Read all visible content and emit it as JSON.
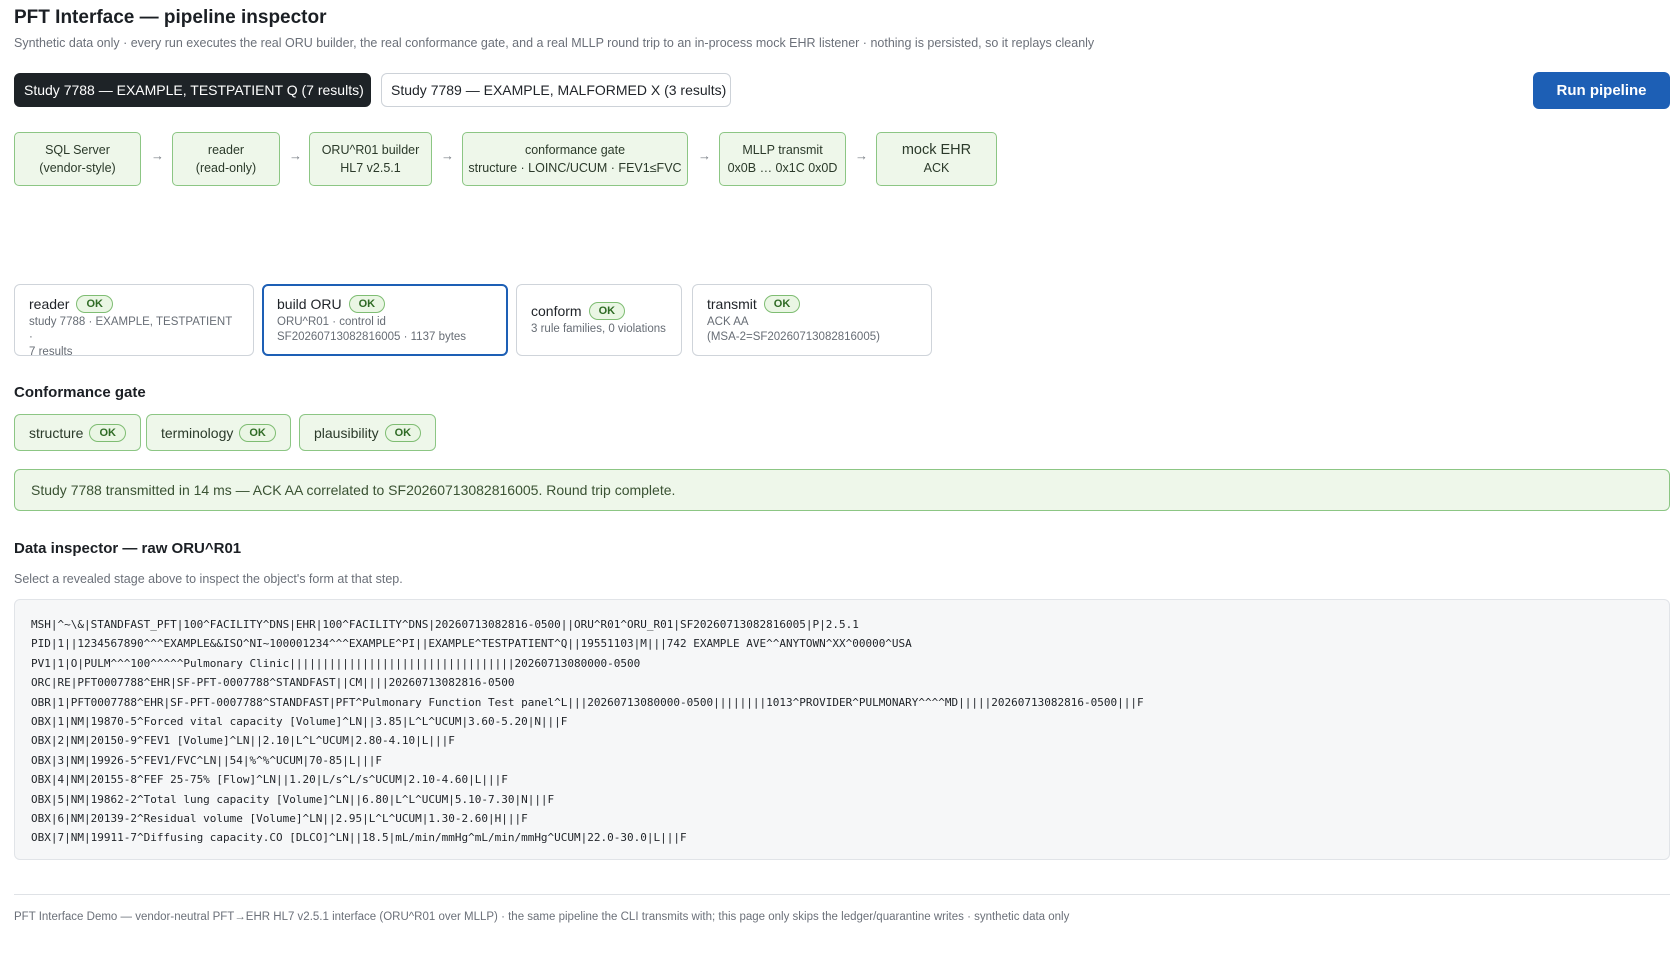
{
  "header": {
    "title": "PFT Interface — pipeline inspector",
    "subtitle": "Synthetic data only · every run executes the real ORU builder, the real conformance gate, and a real MLLP round trip to an in-process mock EHR listener · nothing is persisted, so it replays cleanly"
  },
  "studies": [
    {
      "label": "Study 7788 — EXAMPLE, TESTPATIENT Q (7 results)",
      "selected": true
    },
    {
      "label": "Study 7789 — EXAMPLE, MALFORMED X (3 results)",
      "selected": false
    }
  ],
  "run_button": "Run pipeline",
  "pipeline": [
    {
      "line1": "SQL Server",
      "line2": "(vendor-style)"
    },
    {
      "line1": "reader",
      "line2": "(read-only)"
    },
    {
      "line1": "ORU^R01 builder",
      "line2": "HL7 v2.5.1"
    },
    {
      "line1": "conformance gate",
      "line2": "structure · LOINC/UCUM · FEV1≤FVC"
    },
    {
      "line1": "MLLP transmit",
      "line2": "0x0B … 0x1C 0x0D"
    },
    {
      "line1": "mock EHR",
      "line2": "ACK"
    }
  ],
  "pipeline_arrow": "→",
  "ok_label": "OK",
  "stages": [
    {
      "name": "reader",
      "detail1": "study 7788 · EXAMPLE, TESTPATIENT ·",
      "detail2": "7 results",
      "status": "OK"
    },
    {
      "name": "build ORU",
      "detail1": "ORU^R01 · control id",
      "detail2": "SF20260713082816005 · 1137 bytes",
      "status": "OK",
      "selected": true
    },
    {
      "name": "conform",
      "detail1": "3 rule families, 0 violations",
      "detail2": "",
      "status": "OK"
    },
    {
      "name": "transmit",
      "detail1": "ACK AA",
      "detail2": "(MSA-2=SF20260713082816005)",
      "status": "OK"
    }
  ],
  "conformance": {
    "title": "Conformance gate",
    "families": [
      {
        "name": "structure",
        "status": "OK"
      },
      {
        "name": "terminology",
        "status": "OK"
      },
      {
        "name": "plausibility",
        "status": "OK"
      }
    ]
  },
  "banner": "Study 7788 transmitted in 14 ms — ACK AA correlated to SF20260713082816005. Round trip complete.",
  "inspector": {
    "title": "Data inspector — raw ORU^R01",
    "hint": "Select a revealed stage above to inspect the object's form at that step.",
    "lines": [
      "MSH|^~\\&|STANDFAST_PFT|100^FACILITY^DNS|EHR|100^FACILITY^DNS|20260713082816-0500||ORU^R01^ORU_R01|SF20260713082816005|P|2.5.1",
      "PID|1||1234567890^^^EXAMPLE&&ISO^NI~100001234^^^EXAMPLE^PI||EXAMPLE^TESTPATIENT^Q||19551103|M|||742 EXAMPLE AVE^^ANYTOWN^XX^00000^USA",
      "PV1|1|O|PULM^^^100^^^^^Pulmonary Clinic||||||||||||||||||||||||||||||||||20260713080000-0500",
      "ORC|RE|PFT0007788^EHR|SF-PFT-0007788^STANDFAST||CM||||20260713082816-0500",
      "OBR|1|PFT0007788^EHR|SF-PFT-0007788^STANDFAST|PFT^Pulmonary Function Test panel^L|||20260713080000-0500||||||||1013^PROVIDER^PULMONARY^^^^MD|||||20260713082816-0500|||F",
      "OBX|1|NM|19870-5^Forced vital capacity [Volume]^LN||3.85|L^L^UCUM|3.60-5.20|N|||F",
      "OBX|2|NM|20150-9^FEV1 [Volume]^LN||2.10|L^L^UCUM|2.80-4.10|L|||F",
      "OBX|3|NM|19926-5^FEV1/FVC^LN||54|%^%^UCUM|70-85|L|||F",
      "OBX|4|NM|20155-8^FEF 25-75% [Flow]^LN||1.20|L/s^L/s^UCUM|2.10-4.60|L|||F",
      "OBX|5|NM|19862-2^Total lung capacity [Volume]^LN||6.80|L^L^UCUM|5.10-7.30|N|||F",
      "OBX|6|NM|20139-2^Residual volume [Volume]^LN||2.95|L^L^UCUM|1.30-2.60|H|||F",
      "OBX|7|NM|19911-7^Diffusing capacity.CO [DLCO]^LN||18.5|mL/min/mmHg^mL/min/mmHg^UCUM|22.0-30.0|L|||F"
    ]
  },
  "footer": "PFT Interface Demo — vendor-neutral PFT→EHR HL7 v2.5.1 interface (ORU^R01 over MLLP) · the same pipeline the CLI transmits with; this page only skips the ledger/quarantine writes · synthetic data only",
  "colors": {
    "accent": "#1d5fb5",
    "ok_green": "#2f6b25",
    "ok_border": "#8cc684",
    "ok_fill": "#eef7ea",
    "dark_tab": "#1e2327"
  }
}
